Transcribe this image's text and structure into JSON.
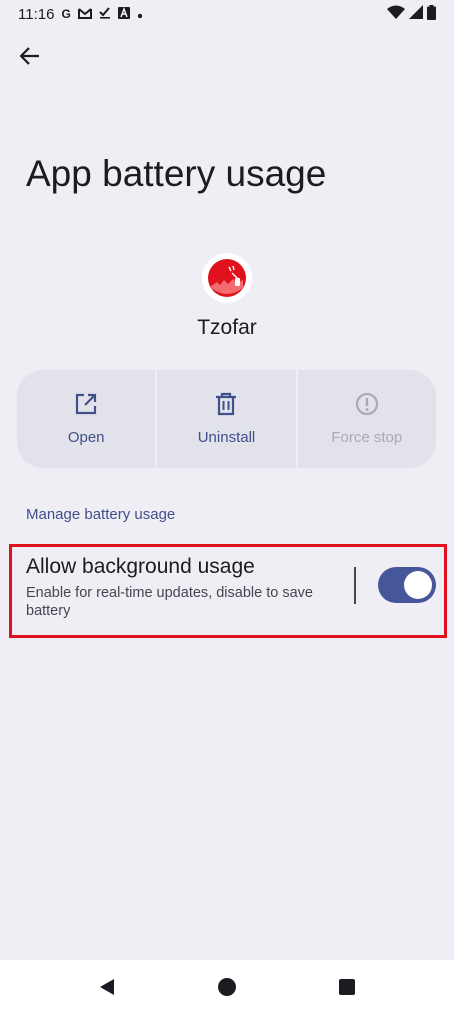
{
  "status_bar": {
    "time": "11:16",
    "notification_icons": [
      "google-icon",
      "gmail-icon",
      "check-icon",
      "a-icon",
      "dot-icon"
    ],
    "system_icons": [
      "wifi-icon",
      "signal-icon",
      "battery-icon"
    ]
  },
  "header": {
    "title": "App battery usage"
  },
  "app": {
    "name": "Tzofar",
    "icon_color": "#e0121e"
  },
  "actions": [
    {
      "label": "Open",
      "enabled": true
    },
    {
      "label": "Uninstall",
      "enabled": true
    },
    {
      "label": "Force stop",
      "enabled": false
    }
  ],
  "section": {
    "header": "Manage battery usage"
  },
  "preference": {
    "title": "Allow background usage",
    "summary": "Enable for real-time updates, disable to save battery",
    "toggle_on": true
  },
  "colors": {
    "accent": "#46569a",
    "highlight_border": "#e0121e",
    "background": "#eeeef4"
  },
  "nav_bar": {
    "icons": [
      "back-icon",
      "home-icon",
      "recents-icon"
    ]
  }
}
